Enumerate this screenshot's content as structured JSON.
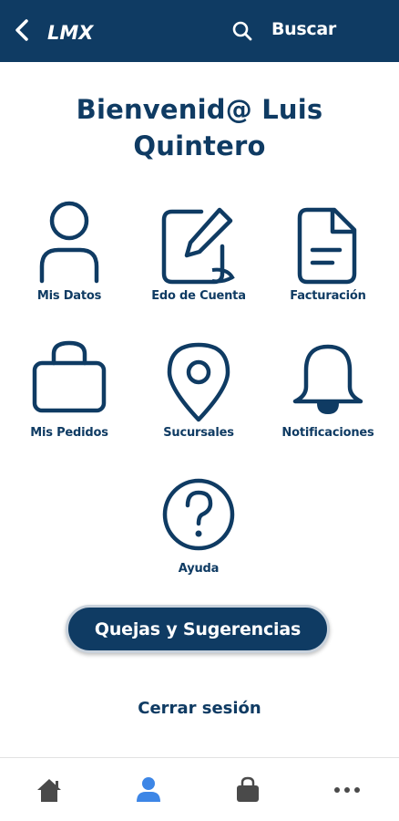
{
  "colors": {
    "primary": "#0f3b63",
    "active_nav": "#3d86e6",
    "inactive_nav": "#4a4a4a"
  },
  "header": {
    "logo_text": "LMX",
    "search_label": "Buscar"
  },
  "welcome": {
    "line1": "Bienvenid@ Luis",
    "line2": "Quintero"
  },
  "menu": {
    "mis_datos": "Mis Datos",
    "edo_cuenta": "Edo de Cuenta",
    "facturacion": "Facturación",
    "mis_pedidos": "Mis Pedidos",
    "sucursales": "Sucursales",
    "notificaciones": "Notificaciones",
    "ayuda": "Ayuda"
  },
  "actions": {
    "quejas": "Quejas y Sugerencias",
    "logout": "Cerrar sesión"
  },
  "bottom_nav": [
    {
      "icon": "home-icon",
      "active": false
    },
    {
      "icon": "user-icon",
      "active": true
    },
    {
      "icon": "bag-icon",
      "active": false
    },
    {
      "icon": "more-icon",
      "active": false
    }
  ]
}
